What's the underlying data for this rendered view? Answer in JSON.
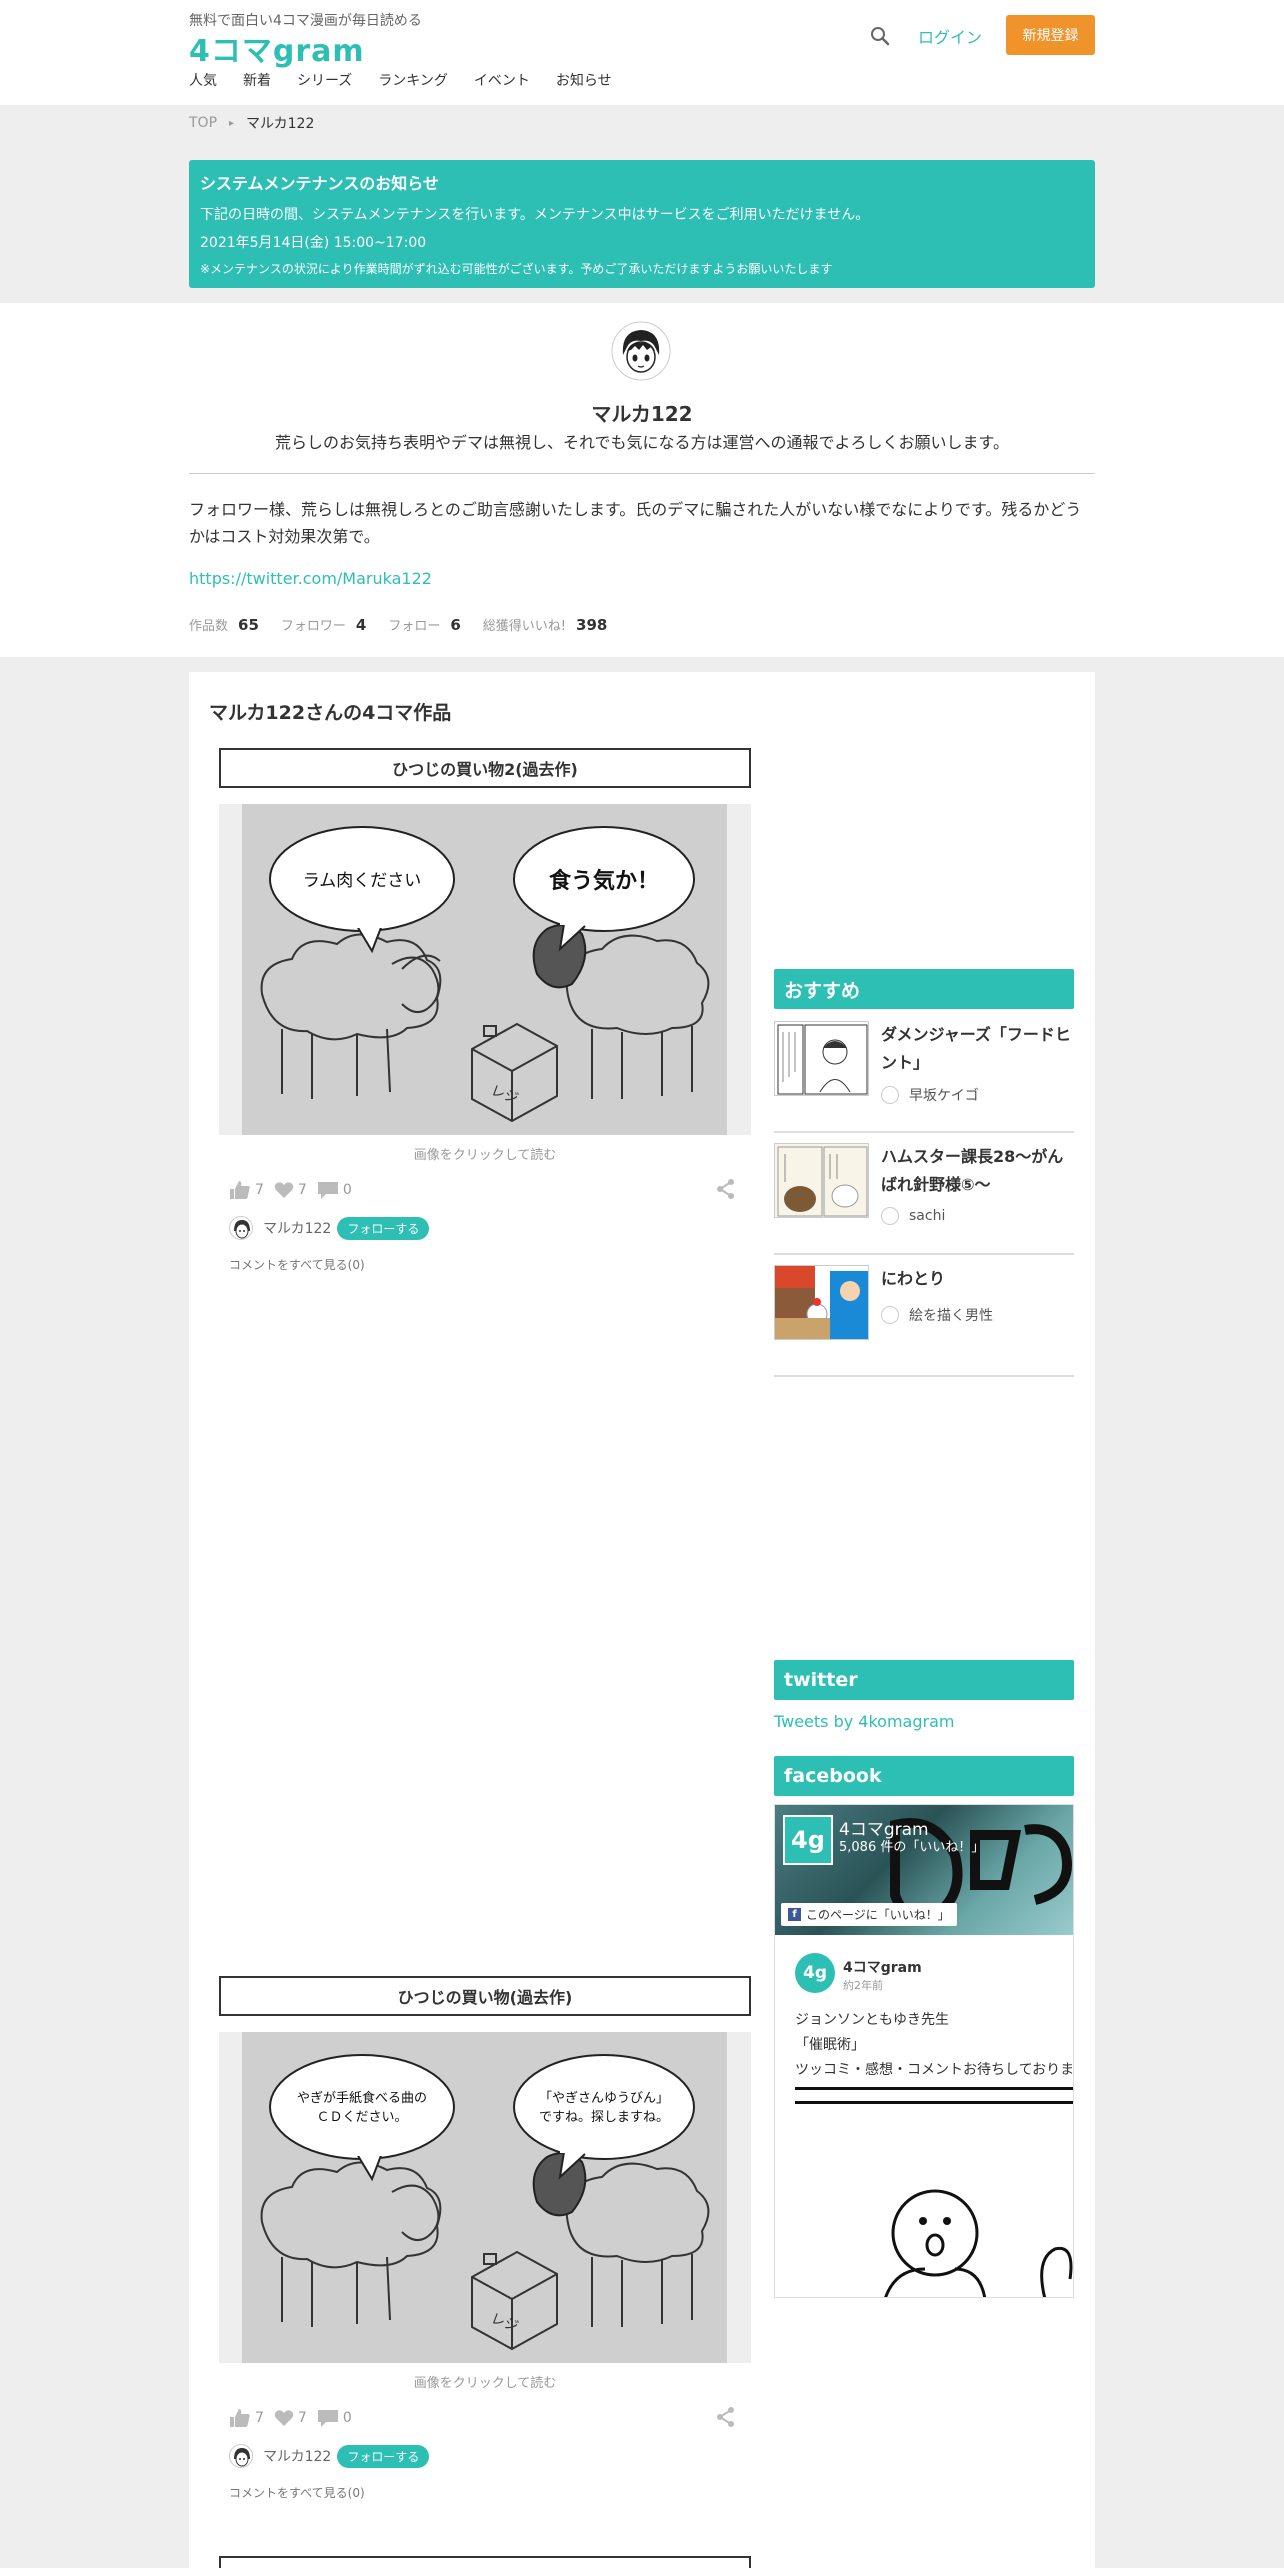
{
  "header": {
    "tagline": "無料で面白い4コマ漫画が毎日読める",
    "logo": "4コマgram",
    "login": "ログイン",
    "signup": "新規登録",
    "nav": [
      "人気",
      "新着",
      "シリーズ",
      "ランキング",
      "イベント",
      "お知らせ"
    ]
  },
  "breadcrumb": {
    "top": "TOP",
    "current": "マルカ122"
  },
  "notice": {
    "title": "システムメンテナンスのお知らせ",
    "line1": "下記の日時の間、システムメンテナンスを行います。メンテナンス中はサービスをご利用いただけません。",
    "line2": "2021年5月14日(金) 15:00~17:00",
    "note": "※メンテナンスの状況により作業時間がずれ込む可能性がございます。予めご了承いただけますようお願いいたします"
  },
  "profile": {
    "name": "マルカ122",
    "bio": "荒らしのお気持ち表明やデマは無視し、それでも気になる方は運営への通報でよろしくお願いします。",
    "description": "フォロワー様、荒らしは無視しろとのご助言感謝いたします。氏のデマに騙された人がいない様でなによりです。残るかどうかはコスト対効果次第で。",
    "link": "https://twitter.com/Maruka122",
    "stats": [
      {
        "label": "作品数",
        "value": "65"
      },
      {
        "label": "フォロワー",
        "value": "4"
      },
      {
        "label": "フォロー",
        "value": "6"
      },
      {
        "label": "総獲得いいね!",
        "value": "398"
      }
    ]
  },
  "main": {
    "title": "マルカ122さんの4コマ作品",
    "works": [
      {
        "title": "ひつじの買い物2(過去作)",
        "bubble_left": "ラム肉ください",
        "bubble_right": "食う気か！",
        "hint": "画像をクリックして読む",
        "likes": "7",
        "hearts": "7",
        "comments": "0",
        "author": "マルカ122",
        "follow": "フォローする",
        "comments_link": "コメントをすべて見る(0)"
      },
      {
        "title": "ひつじの買い物(過去作)",
        "bubble_left_1": "やぎが手紙食べる曲の",
        "bubble_left_2": "ＣＤください。",
        "bubble_right_1": "「やぎさんゆうびん」",
        "bubble_right_2": "ですね。探しますね。",
        "hint": "画像をクリックして読む",
        "likes": "7",
        "hearts": "7",
        "comments": "0",
        "author": "マルカ122",
        "follow": "フォローする",
        "comments_link": "コメントをすべて見る(0)"
      }
    ],
    "sign_on_box": "レジ"
  },
  "sidebar": {
    "recommend_title": "おすすめ",
    "recommend": [
      {
        "title": "ダメンジャーズ「フードヒント」",
        "author": "早坂ケイゴ"
      },
      {
        "title": "ハムスター課長28〜がんばれ針野様⑤〜",
        "author": "sachi"
      },
      {
        "title": "にわとり",
        "author": "絵を描く男性"
      }
    ],
    "twitter_title": "twitter",
    "tweets_link": "Tweets by 4komagram",
    "facebook_title": "facebook",
    "fb": {
      "page_name": "4コマgram",
      "likes": "5,086 件の「いいね！」",
      "like_button": "このページに「いいね！」",
      "logo": "4g",
      "post_author": "4コマgram",
      "post_time": "約2年前",
      "post_line1": "ジョンソンともゆき先生",
      "post_line2": "「催眠術」",
      "post_line3": "ツッコミ・感想・コメントお待ちしておりま"
    }
  },
  "colors": {
    "accent": "#2ebfb4",
    "signup": "#f0932b",
    "background": "#eeeeee"
  }
}
